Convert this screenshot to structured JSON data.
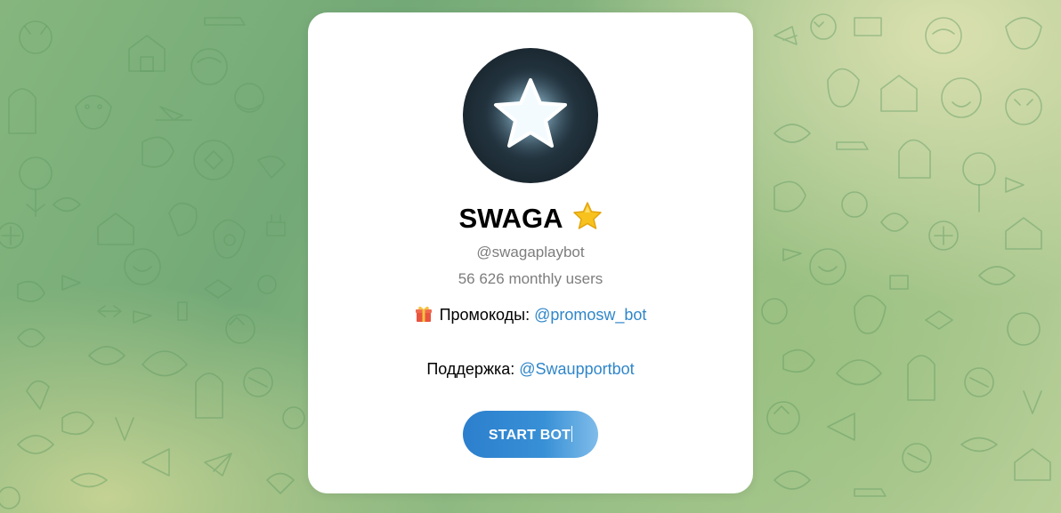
{
  "background": {
    "pattern": "telegram-doodle-wallpaper",
    "colors": [
      "#73a977",
      "#86b67e",
      "#b8cf98",
      "#dee2b2"
    ]
  },
  "bot": {
    "avatar_icon": "glowing-star-icon",
    "name": "SWAGA",
    "name_emoji": "star-emoji",
    "username": "@swagaplaybot",
    "monthly_users": "56 626 monthly users"
  },
  "description": {
    "promo_emoji": "gift-emoji",
    "promo_label": "Промокоды: ",
    "promo_link": "@promosw_bot",
    "support_label": "Поддержка: ",
    "support_link": "@Swaupportbot"
  },
  "actions": {
    "start_label": "START BOT"
  },
  "colors": {
    "link": "#2f86c9",
    "button": "#2c7fcd",
    "muted_text": "#7d7d7d",
    "card": "#ffffff"
  }
}
